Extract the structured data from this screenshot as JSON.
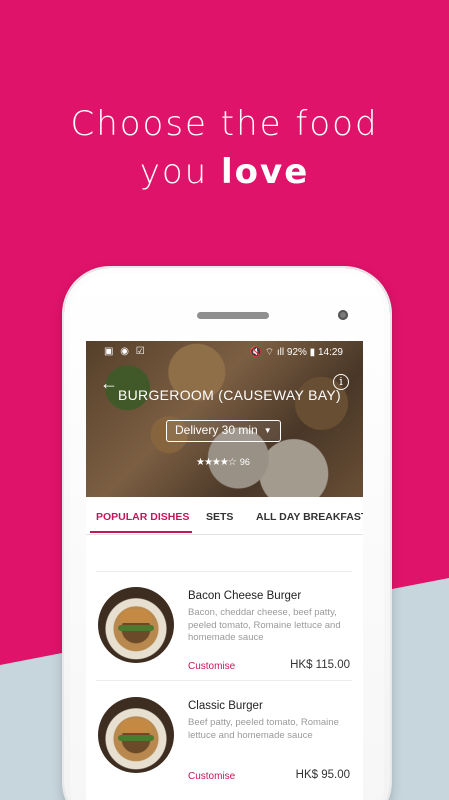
{
  "headline": {
    "line1": "Choose the food",
    "line2_prefix": "you ",
    "line2_bold": "love"
  },
  "status_bar": {
    "left_icons": "▣ ◉ ☑",
    "right": "🔇 ⌔ ıll 92% ▮ 14:29"
  },
  "restaurant": {
    "back_icon": "←",
    "name": "BURGEROOM (CAUSEWAY BAY)",
    "info_icon": "i",
    "delivery_label": "Delivery 30 min",
    "delivery_caret": "▼",
    "stars": "★★★★☆",
    "rating_count": "96"
  },
  "tabs": [
    {
      "label": "POPULAR DISHES",
      "active": true
    },
    {
      "label": "SETS",
      "active": false
    },
    {
      "label": "ALL DAY BREAKFAST",
      "active": false
    }
  ],
  "menu": [
    {
      "name": "Bacon Cheese Burger",
      "description": "Bacon, cheddar cheese, beef patty, peeled tomato, Romaine lettuce and homemade sauce",
      "customise": "Customise",
      "price": "HK$ 115.00"
    },
    {
      "name": "Classic Burger",
      "description": "Beef patty, peeled tomato, Romaine lettuce and homemade sauce",
      "customise": "Customise",
      "price": "HK$ 95.00"
    }
  ],
  "colors": {
    "brand_pink": "#e0136a",
    "accent": "#c2185b",
    "lower_bg": "#c7d5dd"
  }
}
